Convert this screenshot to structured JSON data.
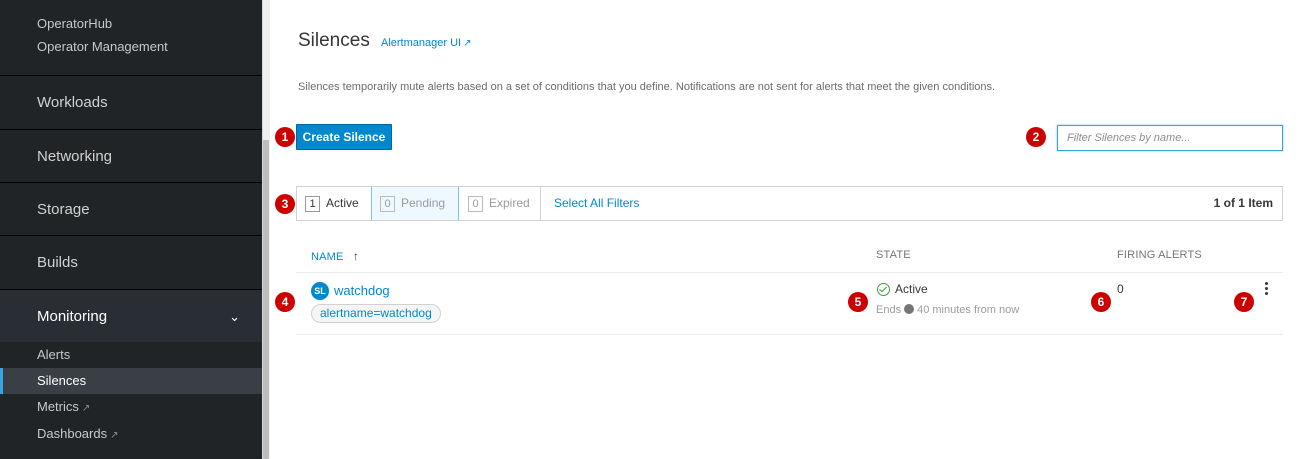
{
  "sidebar": {
    "top_items": [
      "OperatorHub",
      "Operator Management"
    ],
    "sections": [
      "Workloads",
      "Networking",
      "Storage",
      "Builds"
    ],
    "monitoring": {
      "label": "Monitoring",
      "chevron": "chevron-down-icon",
      "items": [
        {
          "label": "Alerts",
          "external": false
        },
        {
          "label": "Silences",
          "external": false,
          "active": true
        },
        {
          "label": "Metrics",
          "external": true
        },
        {
          "label": "Dashboards",
          "external": true
        }
      ]
    }
  },
  "page": {
    "title": "Silences",
    "alertmanager_link": "Alertmanager UI",
    "description": "Silences temporarily mute alerts based on a set of conditions that you define. Notifications are not sent for alerts that meet the given conditions.",
    "create_button": "Create Silence",
    "filter_placeholder": "Filter Silences by name..."
  },
  "filters": {
    "active": {
      "count": "1",
      "label": "Active"
    },
    "pending": {
      "count": "0",
      "label": "Pending"
    },
    "expired": {
      "count": "0",
      "label": "Expired"
    },
    "select_all": "Select All Filters",
    "item_count": "1 of 1 Item"
  },
  "table": {
    "headers": {
      "name": "NAME",
      "state": "STATE",
      "firing": "FIRING ALERTS"
    },
    "sort_icon": "sort-ascending-icon",
    "rows": [
      {
        "badge": "SL",
        "name": "watchdog",
        "matcher": "alertname=watchdog",
        "state": "Active",
        "ends_prefix": "Ends",
        "ends_text": "40 minutes from now",
        "firing_alerts": "0"
      }
    ]
  },
  "callouts": [
    "1",
    "2",
    "3",
    "4",
    "5",
    "6",
    "7"
  ],
  "colors": {
    "accent": "#0088ce",
    "sidebar_bg": "#212427",
    "callout": "#cc0000",
    "success": "#3f9c35"
  }
}
